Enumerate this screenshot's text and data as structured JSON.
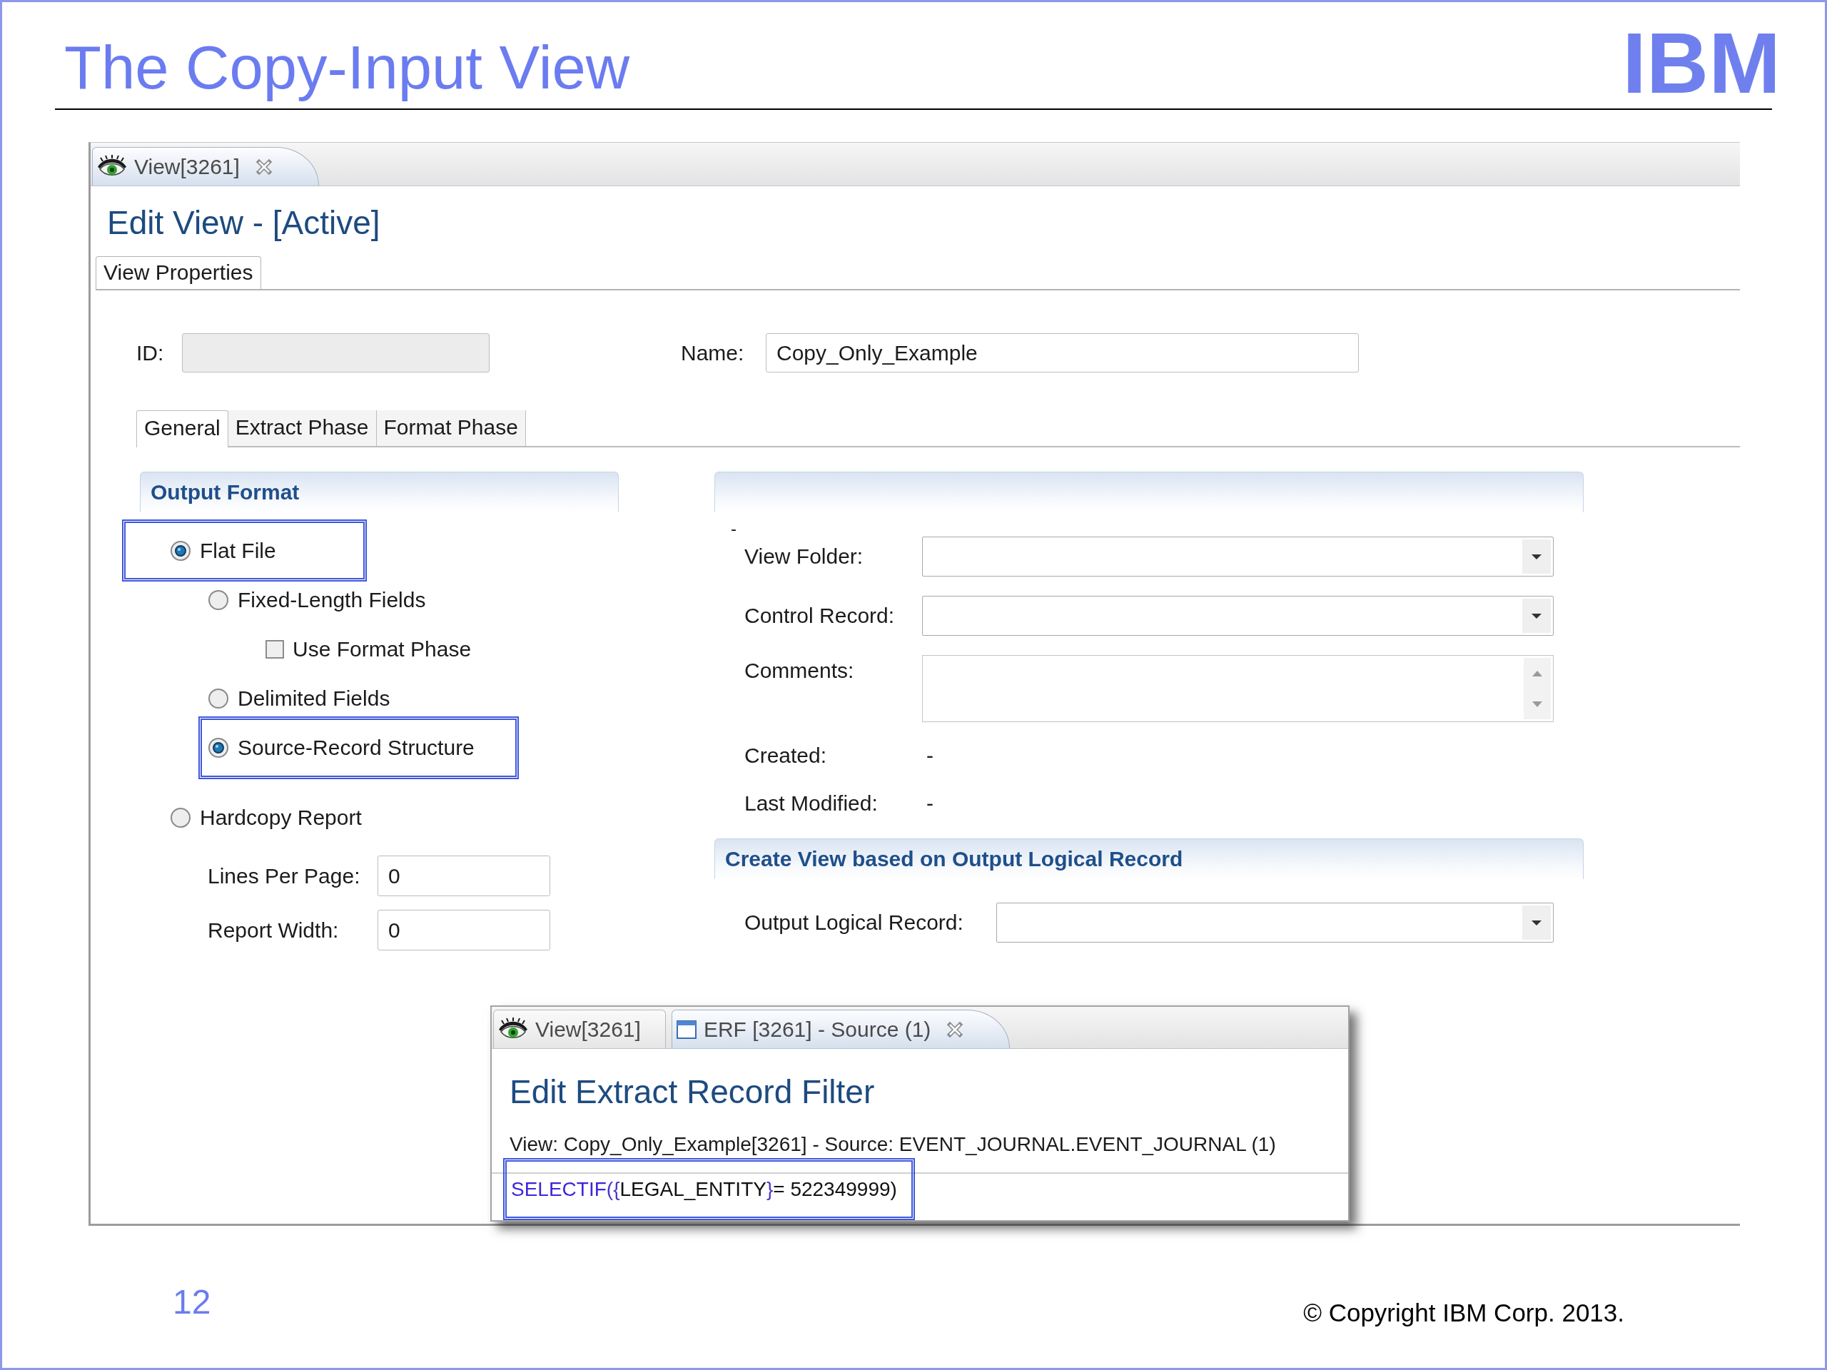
{
  "slide": {
    "title": "The Copy-Input View",
    "logo": "IBM",
    "page_number": "12",
    "copyright": "© Copyright IBM Corp. 2013."
  },
  "editor": {
    "tabs": [
      {
        "kind": "view",
        "label": "View[3261]",
        "selected": true,
        "closable": true
      }
    ],
    "title": "Edit View - [Active]",
    "page_tabs": [
      {
        "label": "View Properties",
        "selected": true
      }
    ],
    "id_field": {
      "label": "ID:",
      "disabled": true
    },
    "name_field": {
      "label": "Name:",
      "value": "Copy_Only_Example"
    },
    "section_tabs": [
      {
        "label": "General",
        "selected": true
      },
      {
        "label": "Extract Phase",
        "selected": false
      },
      {
        "label": "Format Phase",
        "selected": false
      }
    ],
    "output_format": {
      "title": "Output Format",
      "options": [
        {
          "kind": "radio",
          "label": "Flat File",
          "selected": true,
          "highlighted": true,
          "children": [
            {
              "kind": "radio",
              "label": "Fixed-Length Fields",
              "selected": false,
              "highlighted": false,
              "children": [
                {
                  "kind": "checkbox",
                  "label": "Use Format Phase",
                  "checked": false,
                  "highlighted": false
                }
              ]
            },
            {
              "kind": "radio",
              "label": "Delimited Fields",
              "selected": false,
              "highlighted": false
            },
            {
              "kind": "radio",
              "label": "Source-Record Structure",
              "selected": true,
              "highlighted": true
            }
          ]
        },
        {
          "kind": "radio",
          "label": "Hardcopy Report",
          "selected": false,
          "highlighted": false,
          "children": [
            {
              "kind": "field",
              "label": "Lines Per Page:",
              "value": "0"
            },
            {
              "kind": "field",
              "label": "Report Width:",
              "value": "0"
            }
          ]
        }
      ]
    },
    "details": {
      "dash": "-",
      "fields": [
        {
          "kind": "dropdown",
          "label": "View Folder:"
        },
        {
          "kind": "dropdown",
          "label": "Control Record:"
        },
        {
          "kind": "textarea",
          "label": "Comments:"
        },
        {
          "kind": "text",
          "label": "Created:",
          "value": "-"
        },
        {
          "kind": "text",
          "label": "Last Modified:",
          "value": "-"
        }
      ]
    },
    "logical_record": {
      "title": "Create View based on Output Logical Record",
      "fields": [
        {
          "kind": "dropdown",
          "label": "Output Logical Record:"
        }
      ]
    }
  },
  "filter_window": {
    "tabs": [
      {
        "kind": "view",
        "label": "View[3261]",
        "selected": false,
        "closable": false
      },
      {
        "kind": "filter",
        "label": "ERF [3261] - Source (1)",
        "selected": true,
        "closable": true
      }
    ],
    "title": "Edit Extract Record Filter",
    "description": "View: Copy_Only_Example[3261] - Source: EVENT_JOURNAL.EVENT_JOURNAL (1)",
    "code": {
      "highlighted": true,
      "tokens": [
        {
          "kind": "keyword",
          "text": "SELECTIF"
        },
        {
          "kind": "brace",
          "text": "({"
        },
        {
          "kind": "plain",
          "text": "LEGAL_ENTITY"
        },
        {
          "kind": "brace",
          "text": "}"
        },
        {
          "kind": "plain",
          "text": "= 522349999)"
        }
      ]
    }
  }
}
